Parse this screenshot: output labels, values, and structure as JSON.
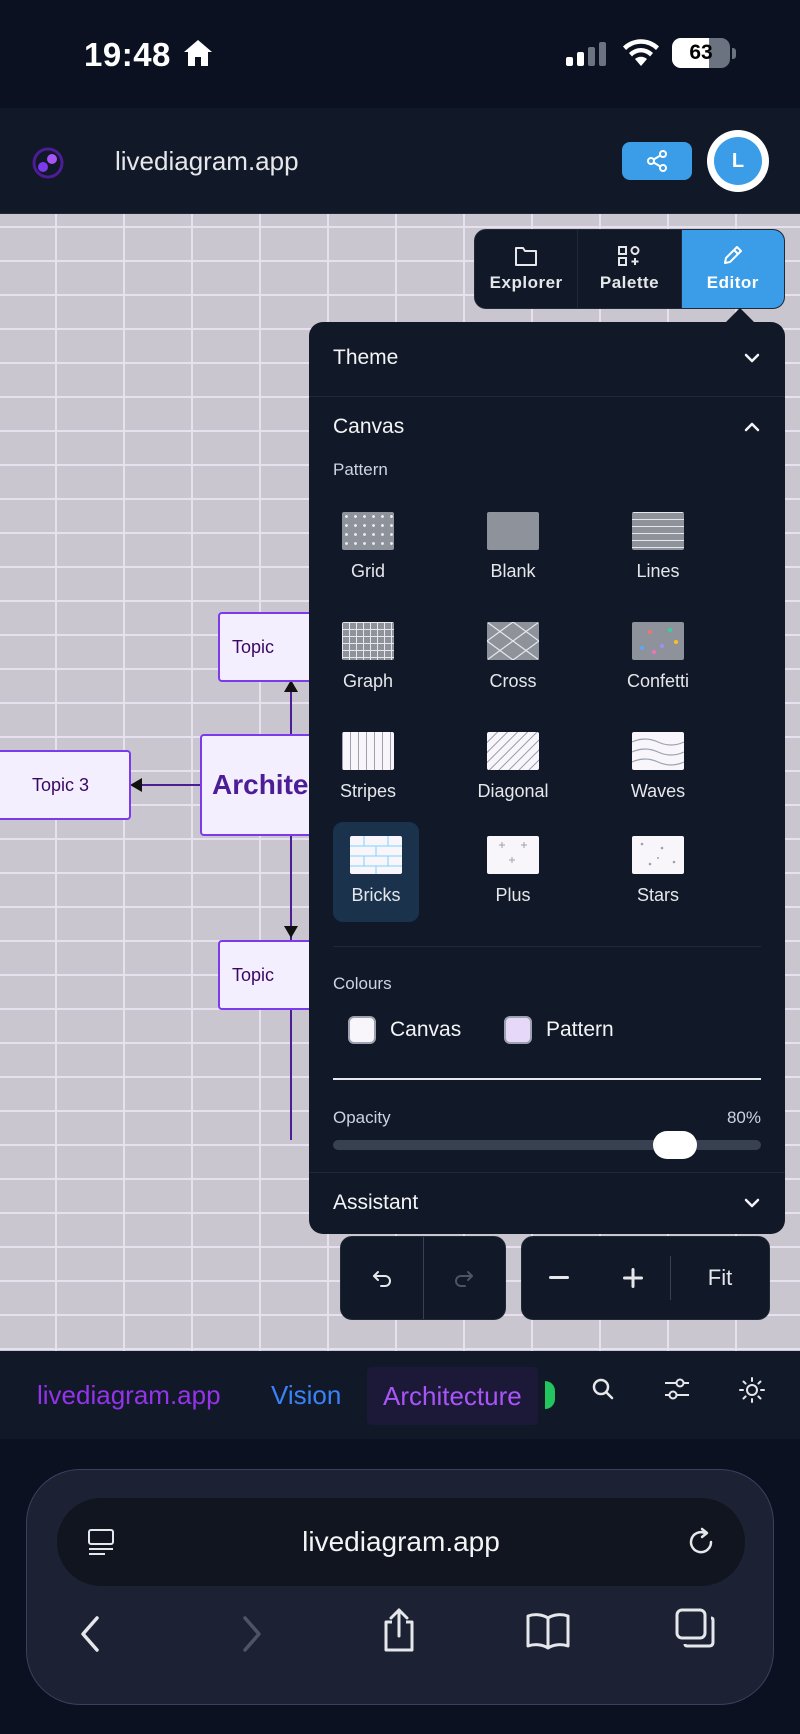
{
  "status_bar": {
    "time": "19:48",
    "battery": "63",
    "battery_level": 0.63
  },
  "header": {
    "title": "livediagram.app",
    "avatar_initial": "L"
  },
  "canvas": {
    "nodes": [
      {
        "label": "Topic"
      },
      {
        "label": "Topic 3"
      },
      {
        "label": "Architec"
      },
      {
        "label": "Topic"
      }
    ]
  },
  "toolbar": {
    "tabs": [
      {
        "label": "Explorer",
        "icon": "folder-icon"
      },
      {
        "label": "Palette",
        "icon": "palette-icon"
      },
      {
        "label": "Editor",
        "icon": "pencil-icon"
      }
    ],
    "active_tab": "Editor"
  },
  "editor": {
    "theme_label": "Theme",
    "canvas_label": "Canvas",
    "pattern_label": "Pattern",
    "patterns": [
      "Grid",
      "Blank",
      "Lines",
      "Graph",
      "Cross",
      "Confetti",
      "Stripes",
      "Diagonal",
      "Waves",
      "Bricks",
      "Plus",
      "Stars"
    ],
    "selected_pattern": "Bricks",
    "colours_label": "Colours",
    "canvas_colour_label": "Canvas",
    "canvas_colour": "#f8f5fb",
    "pattern_colour_label": "Pattern",
    "pattern_colour": "#e6d8f8",
    "opacity_label": "Opacity",
    "opacity_value": "80%",
    "opacity": 0.8,
    "assistant_label": "Assistant"
  },
  "zoom": {
    "fit_label": "Fit"
  },
  "doc_tabs": [
    {
      "label": "livediagram.app",
      "color": "#9333ea"
    },
    {
      "label": "Vision",
      "color": "#3b82f6"
    },
    {
      "label": "Architecture",
      "color": "#a855f7"
    }
  ],
  "browser": {
    "url": "livediagram.app"
  },
  "colors": {
    "accent": "#3b9de8",
    "panel": "#111827",
    "node_border": "#7c3aed"
  }
}
